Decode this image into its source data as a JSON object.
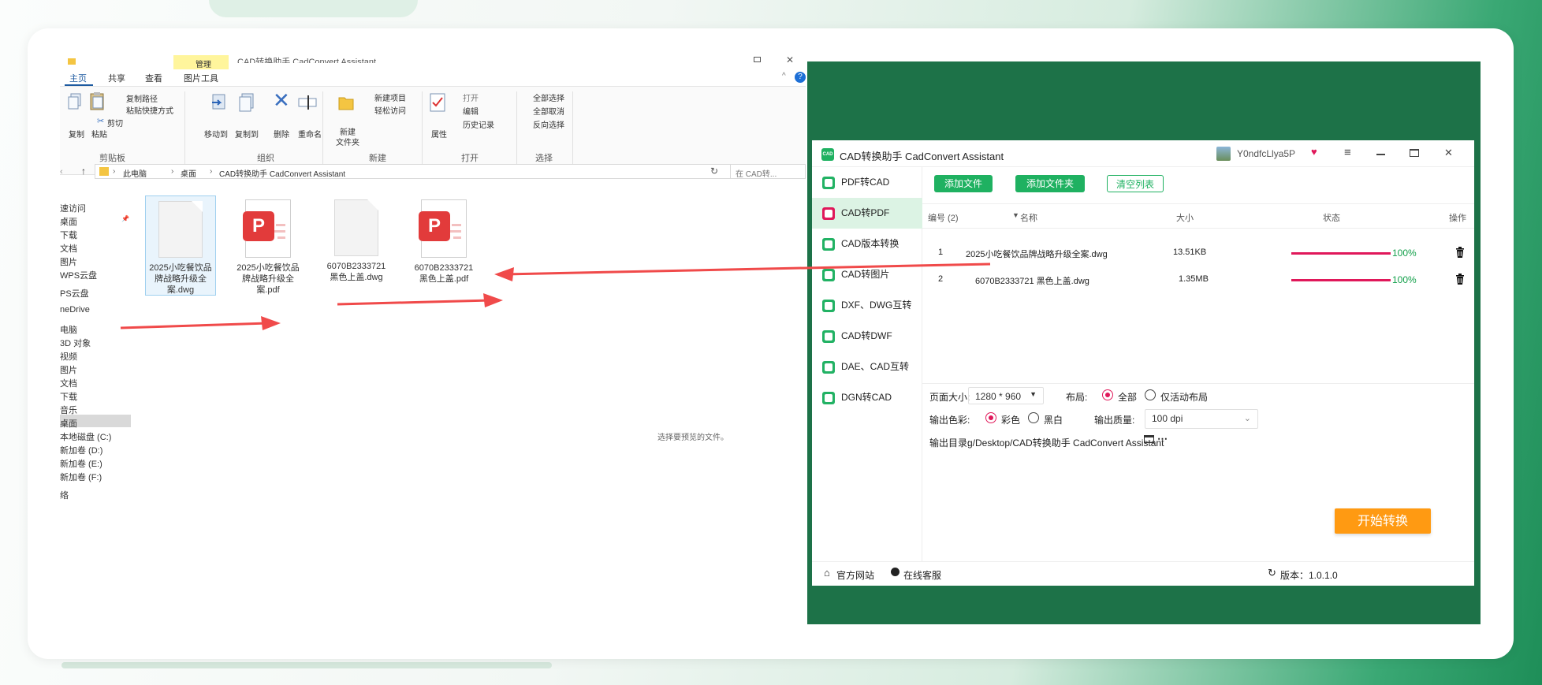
{
  "explorer": {
    "title": "CAD转换助手 CadConvert Assistant",
    "ribbon_tabs": [
      "主页",
      "共享",
      "查看",
      "图片工具"
    ],
    "manage_tag": "管理",
    "clipboard": {
      "copy": "复制",
      "paste": "粘贴",
      "copy_path": "复制路径",
      "paste_shortcut": "粘贴快捷方式",
      "cut": "剪切",
      "group": "剪贴板"
    },
    "organize": {
      "move_to": "移动到",
      "copy_to": "复制到",
      "delete": "删除",
      "rename": "重命名",
      "group": "组织"
    },
    "new": {
      "new_folder": "新建\n文件夹",
      "new_item": "新建项目",
      "easy_access": "轻松访问",
      "group": "新建"
    },
    "open": {
      "properties": "属性",
      "open": "打开",
      "edit": "编辑",
      "history": "历史记录",
      "group": "打开"
    },
    "select": {
      "select_all": "全部选择",
      "select_none": "全部取消",
      "invert": "反向选择",
      "group": "选择"
    },
    "address": [
      "此电脑",
      "桌面",
      "CAD转换助手 CadConvert Assistant"
    ],
    "search_placeholder": "在 CAD转...",
    "nav": [
      "速访问",
      "桌面",
      "下载",
      "文档",
      "图片",
      "WPS云盘",
      "PS云盘",
      "neDrive",
      "电脑",
      "3D 对象",
      "视频",
      "图片",
      "文档",
      "下载",
      "音乐",
      "桌面",
      "本地磁盘 (C:)",
      "新加卷 (D:)",
      "新加卷 (E:)",
      "新加卷 (F:)",
      "络"
    ],
    "files": [
      {
        "name": "2025小吃餐饮品牌战略升级全案.dwg",
        "type": "dwg"
      },
      {
        "name": "2025小吃餐饮品牌战略升级全案.pdf",
        "type": "pdf"
      },
      {
        "name": "6070B2333721 黑色上盖.dwg",
        "type": "dwg"
      },
      {
        "name": "6070B2333721 黑色上盖.pdf",
        "type": "pdf"
      }
    ],
    "preview_hint": "选择要预览的文件。"
  },
  "app": {
    "title": "CAD转换助手 CadConvert Assistant",
    "logo": "CAD",
    "username": "Y0ndfcLlya5P",
    "sidebar": [
      "PDF转CAD",
      "CAD转PDF",
      "CAD版本转换",
      "CAD转图片",
      "DXF、DWG互转",
      "CAD转DWF",
      "DAE、CAD互转",
      "DGN转CAD"
    ],
    "active_index": 1,
    "toolbar": {
      "add_file": "添加文件",
      "add_folder": "添加文件夹",
      "clear": "清空列表"
    },
    "table_headers": {
      "index": "编号 (2)",
      "name": "名称",
      "size": "大小",
      "status": "状态",
      "action": "操作"
    },
    "rows": [
      {
        "index": "1",
        "name": "2025小吃餐饮品牌战略升级全案.dwg",
        "size": "13.51KB",
        "progress": "100%"
      },
      {
        "index": "2",
        "name": "6070B2333721 黑色上盖.dwg",
        "size": "1.35MB",
        "progress": "100%"
      }
    ],
    "settings": {
      "page_size_label": "页面大小:",
      "page_size": "1280 * 960",
      "layout_label": "布局:",
      "layout_all": "全部",
      "layout_active": "仅活动布局",
      "color_label": "输出色彩:",
      "color_color": "彩色",
      "color_bw": "黑白",
      "quality_label": "输出质量:",
      "quality": "100 dpi",
      "output_label": "输出目录:",
      "output_path": "g/Desktop/CAD转换助手 CadConvert Assistant"
    },
    "start_button": "开始转换",
    "footer": {
      "website": "官方网站",
      "support": "在线客服",
      "version": "版本：1.0.1.0"
    },
    "colors": {
      "accent": "#1fb161",
      "progress": "#e0185a",
      "start": "#ff9a12",
      "frame": "#1d7248"
    }
  }
}
